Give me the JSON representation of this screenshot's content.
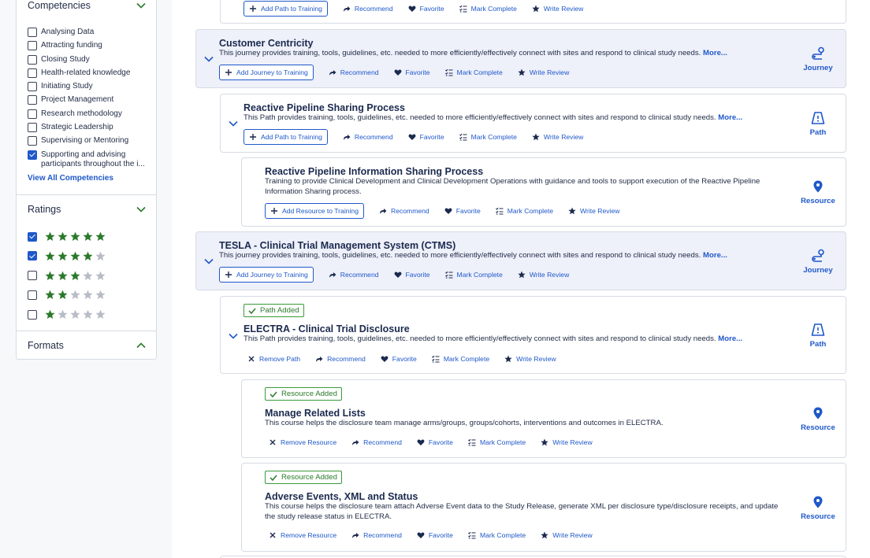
{
  "filters": {
    "competencies": {
      "title": "Competencies",
      "items": [
        {
          "label": "Analysing Data",
          "checked": false
        },
        {
          "label": "Attracting funding",
          "checked": false
        },
        {
          "label": "Closing Study",
          "checked": false
        },
        {
          "label": "Health-related knowledge",
          "checked": false
        },
        {
          "label": "Initiating Study",
          "checked": false
        },
        {
          "label": "Project Management",
          "checked": false
        },
        {
          "label": "Research methodology",
          "checked": false
        },
        {
          "label": "Strategic Leadership",
          "checked": false
        },
        {
          "label": "Supervising or Mentoring",
          "checked": false
        },
        {
          "label": "Supporting and advising participants throughout the i...",
          "checked": true
        }
      ],
      "view_all": "View All Competencies"
    },
    "ratings": {
      "title": "Ratings",
      "rows": [
        {
          "stars": 5,
          "checked": true
        },
        {
          "stars": 4,
          "checked": true
        },
        {
          "stars": 3,
          "checked": false
        },
        {
          "stars": 2,
          "checked": false
        },
        {
          "stars": 1,
          "checked": false
        }
      ]
    },
    "formats": {
      "title": "Formats"
    }
  },
  "colors": {
    "accent": "#1f58c9",
    "star_filled": "#2b7a2b",
    "star_empty": "#b8bcc6",
    "journey_bg": "#eef0fa"
  },
  "common": {
    "more": "More...",
    "add_journey": "Add Journey to Training",
    "add_path": "Add Path to Training",
    "add_resource": "Add Resource to Training",
    "remove_path": "Remove Path",
    "remove_resource": "Remove Resource",
    "recommend": "Recommend",
    "favorite": "Favorite",
    "mark_complete": "Mark Complete",
    "write_review": "Write Review",
    "journey": "Journey",
    "path": "Path",
    "resource": "Resource",
    "path_added": "Path Added",
    "resource_added": "Resource Added"
  },
  "cards": {
    "customer_centricity": {
      "title": "Customer Centricity",
      "desc": "This journey provides training, tools, guidelines, etc. needed to more efficiently/effectively connect with sites and respond to clinical study needs."
    },
    "reactive_pipeline_path": {
      "title": "Reactive Pipeline Sharing Process",
      "desc": "This Path provides training, tools, guidelines, etc. needed to more efficiently/effectively connect with sites and respond to clinical study needs."
    },
    "reactive_pipeline_resource": {
      "title": "Reactive Pipeline Information Sharing Process",
      "desc": "Training to provide Clinical Development and Clinical Development Operations with guidance and tools to support execution of the Reactive Pipeline Information Sharing process."
    },
    "tesla": {
      "title": "TESLA - Clinical Trial Management System (CTMS)",
      "desc": "This journey provides training, tools, guidelines, etc. needed to more efficiently/effectively connect with sites and respond to clinical study needs."
    },
    "electra": {
      "title": "ELECTRA - Clinical Trial Disclosure",
      "desc": "This Path provides training, tools, guidelines, etc. needed to more efficiently/effectively connect with sites and respond to clinical study needs."
    },
    "manage_lists": {
      "title": "Manage Related Lists",
      "desc": "This course helps the disclosure team manage arms/groups, groups/cohorts, interventions and outcomes in ELECTRA."
    },
    "adverse_events": {
      "title": "Adverse Events, XML and Status",
      "desc": "This course helps the disclosure team attach Adverse Event data to the Study Release, generate XML per disclosure type/disclosure receipts, and update the study release status in ELECTRA."
    }
  }
}
